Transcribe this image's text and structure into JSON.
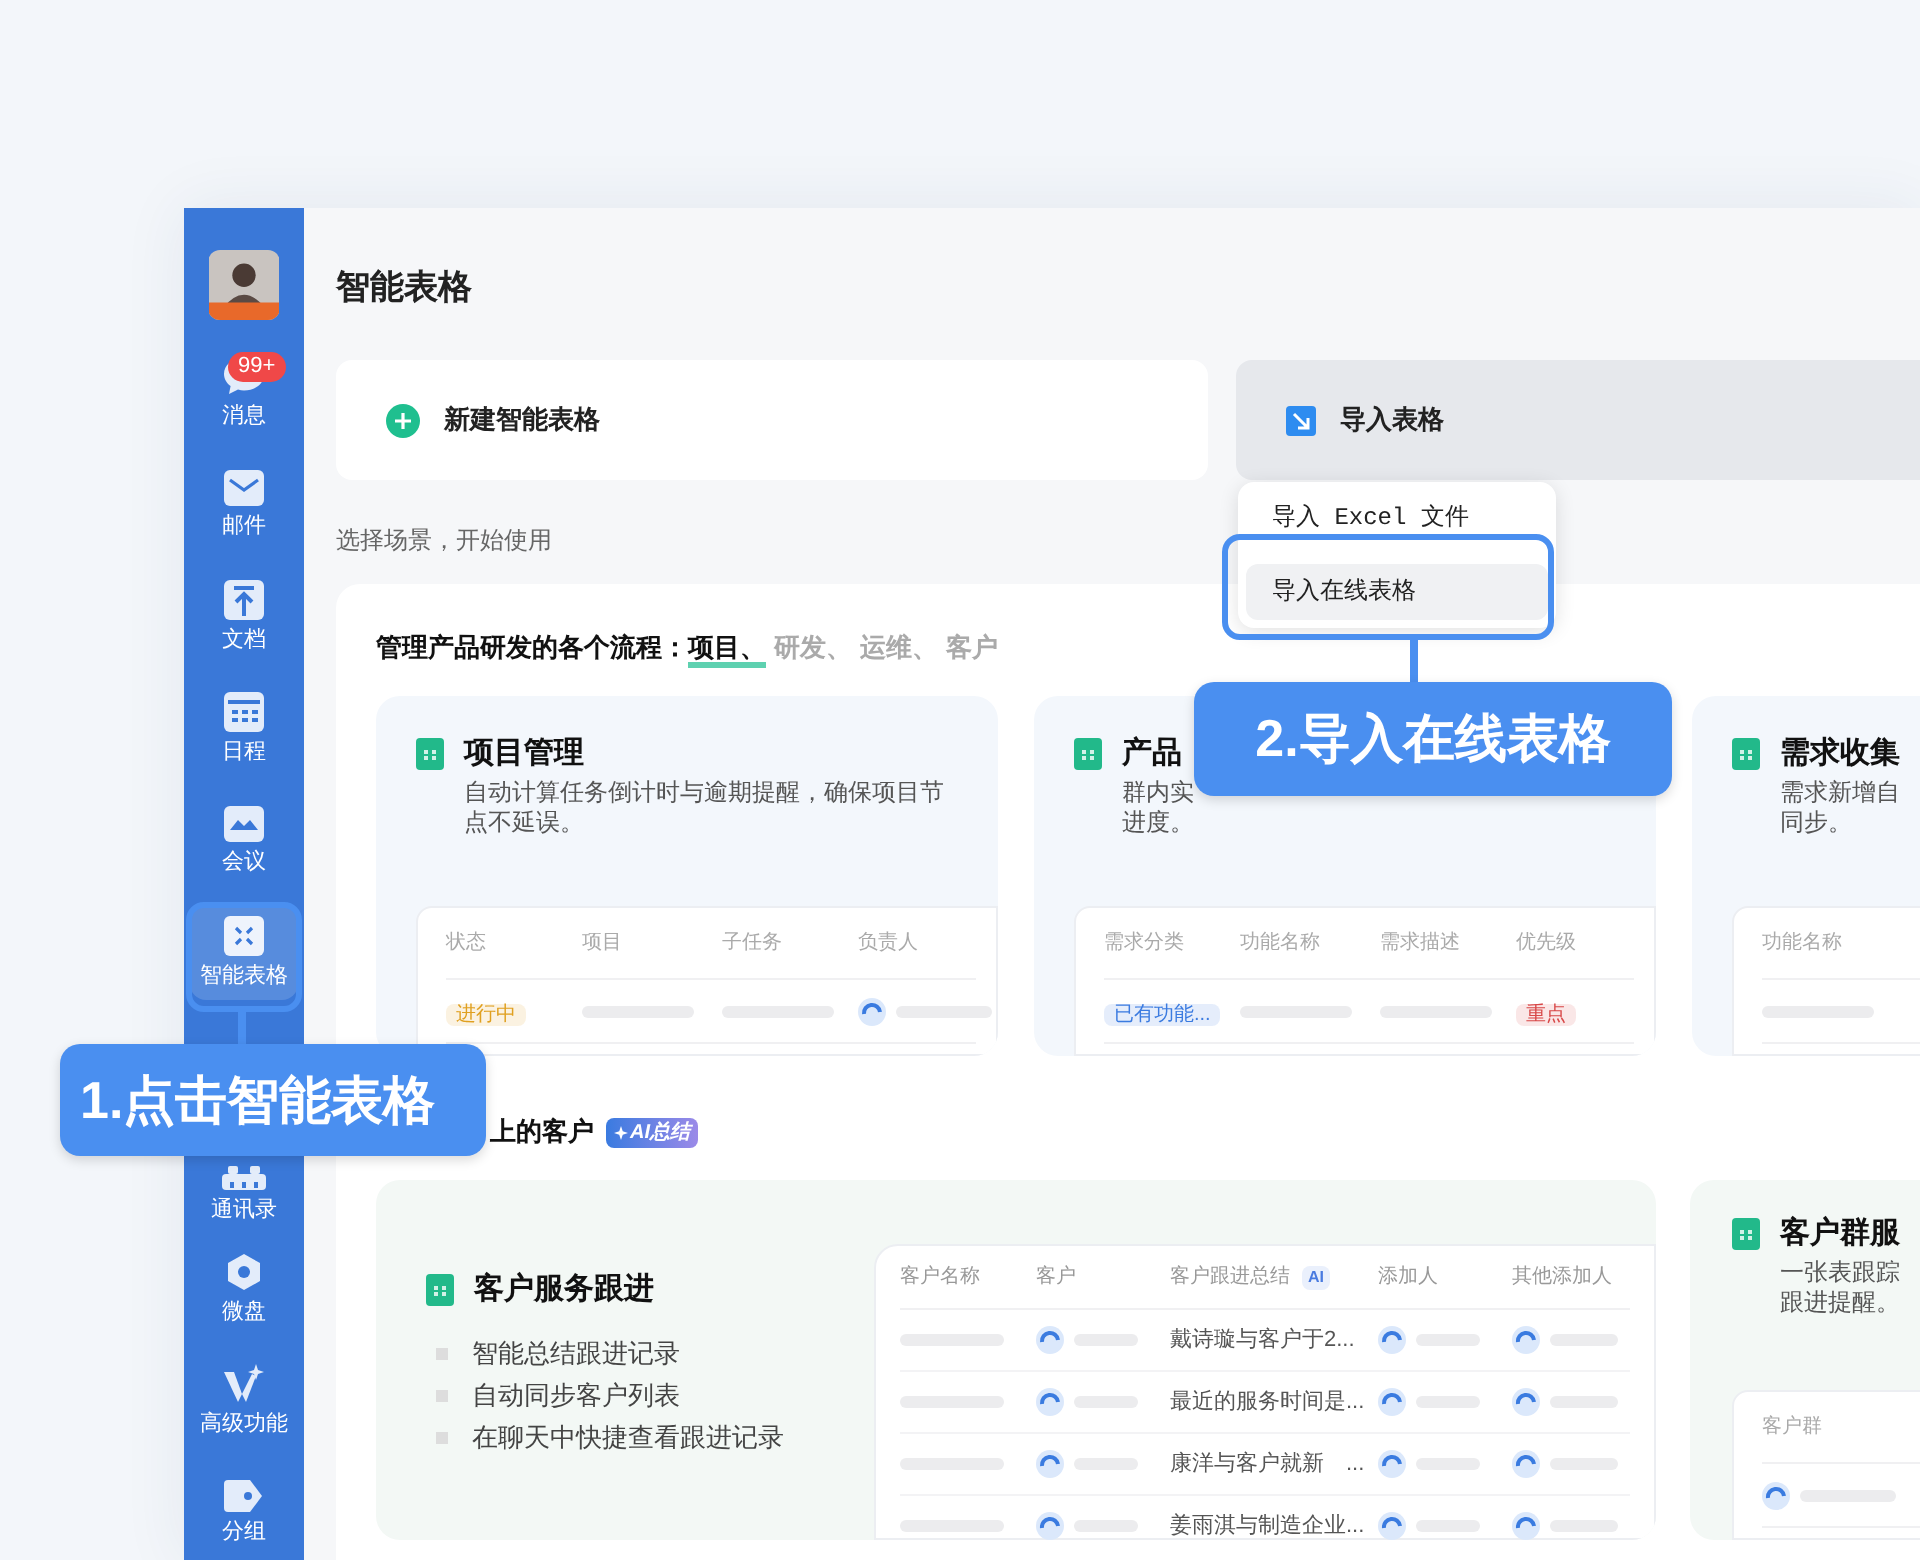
{
  "window": {
    "title": "智能表格"
  },
  "sidebar": {
    "items": [
      {
        "label": "消息",
        "badge": "99+",
        "selected": false
      },
      {
        "label": "邮件",
        "selected": false
      },
      {
        "label": "文档",
        "selected": false
      },
      {
        "label": "日程",
        "selected": false
      },
      {
        "label": "会议",
        "selected": false
      },
      {
        "label": "智能表格",
        "selected": true
      },
      {
        "label": "通讯录",
        "selected": false
      },
      {
        "label": "微盘",
        "selected": false
      },
      {
        "label": "高级功能",
        "selected": false
      },
      {
        "label": "分组",
        "selected": false
      }
    ]
  },
  "actions": [
    {
      "label": "新建智能表格",
      "active": false
    },
    {
      "label": "导入表格",
      "active": true
    }
  ],
  "import_menu": {
    "items": [
      {
        "label": "导入 Excel 文件",
        "highlighted": false
      },
      {
        "label": "导入在线表格",
        "highlighted": true
      }
    ]
  },
  "scene_hint": "选择场景，开始使用",
  "section_1": {
    "heading": "管理产品研发的各个流程：",
    "tabs": [
      {
        "label": "项目、",
        "selected": true
      },
      {
        "label": "研发、",
        "selected": false
      },
      {
        "label": "运维、",
        "selected": false
      },
      {
        "label": "客户",
        "selected": false
      }
    ],
    "templates": [
      {
        "title": "项目管理",
        "description": [
          "自动计算任务倒计时与逾期提醒，确保项目节点不延误。"
        ],
        "columns": [
          "状态",
          "项目",
          "子任务",
          "负责人"
        ],
        "row": [
          {
            "kind": "tag",
            "text": "进行中",
            "color": "#e0a020"
          },
          {
            "kind": "bar"
          },
          {
            "kind": "bar"
          },
          {
            "kind": "person"
          }
        ]
      },
      {
        "title": "产品",
        "description": [
          "群内实",
          "进度。"
        ],
        "columns": [
          "需求分类",
          "功能名称",
          "需求描述",
          "优先级"
        ],
        "row": [
          {
            "kind": "tag",
            "text": "已有功能...",
            "color": "#3b7be0"
          },
          {
            "kind": "bar"
          },
          {
            "kind": "bar"
          },
          {
            "kind": "tag",
            "text": "重点",
            "color": "#d84848"
          }
        ]
      },
      {
        "title": "需求收集",
        "description": [
          "需求新增自",
          "同步。"
        ],
        "columns": [
          "功能名称"
        ],
        "row": [
          {
            "kind": "bar"
          }
        ]
      }
    ]
  },
  "section_2": {
    "heading": "上的客户",
    "badge": "AI总结",
    "featured": {
      "title": "客户服务跟进",
      "bullets": [
        "智能总结跟进记录",
        "自动同步客户列表",
        "在聊天中快捷查看跟进记录"
      ],
      "columns": [
        {
          "label": "客户名称"
        },
        {
          "label": "客户"
        },
        {
          "label": "客户跟进总结",
          "badge": "AI"
        },
        {
          "label": "添加人"
        },
        {
          "label": "其他添加人"
        }
      ],
      "rows": [
        {
          "summary": "戴诗璇与客户于2..."
        },
        {
          "summary": "最近的服务时间是..."
        },
        {
          "summary": "康洋与客户就新　..."
        },
        {
          "summary": "姜雨淇与制造企业..."
        }
      ]
    },
    "templates": [
      {
        "title": "客户群服",
        "description": [
          "一张表跟踪",
          "跟进提醒。"
        ],
        "columns": [
          "客户群"
        ],
        "row": [
          {
            "kind": "person"
          }
        ]
      }
    ]
  },
  "annotations": [
    {
      "text": "1.点击智能表格"
    },
    {
      "text": "2.导入在线表格"
    }
  ]
}
